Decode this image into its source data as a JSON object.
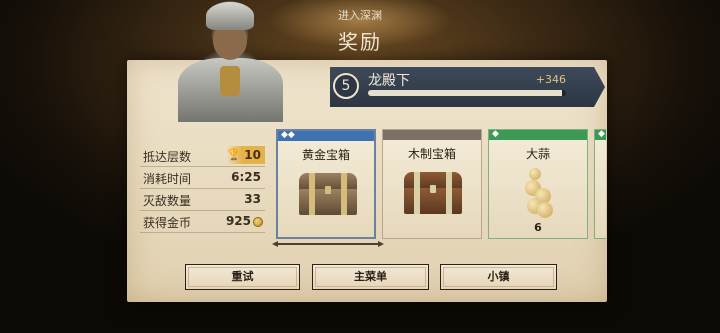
{
  "header": {
    "subtitle": "进入深渊",
    "title": "奖励"
  },
  "level": {
    "number": "5",
    "name": "龙殿下",
    "gain": "+346",
    "progress_fraction": 0.98
  },
  "stats": [
    {
      "label": "抵达层数",
      "value": "10",
      "icon": "trophy-icon"
    },
    {
      "label": "消耗时间",
      "value": "6:25"
    },
    {
      "label": "灭敌数量",
      "value": "33"
    },
    {
      "label": "获得金币",
      "value": "925",
      "icon": "coin-icon"
    }
  ],
  "rewards": [
    {
      "name": "黄金宝箱",
      "rarity_band_color": "#3f72b0",
      "icon": "gold-chest-icon",
      "selected": true,
      "count": ""
    },
    {
      "name": "木制宝箱",
      "rarity_band_color": "#7a7066",
      "icon": "wood-chest-icon",
      "selected": false,
      "count": ""
    },
    {
      "name": "大蒜",
      "rarity_band_color": "#3d9a56",
      "icon": "garlic-icon",
      "selected": false,
      "count": "6"
    }
  ],
  "buttons": {
    "retry": "重试",
    "main_menu": "主菜单",
    "town": "小镇"
  }
}
